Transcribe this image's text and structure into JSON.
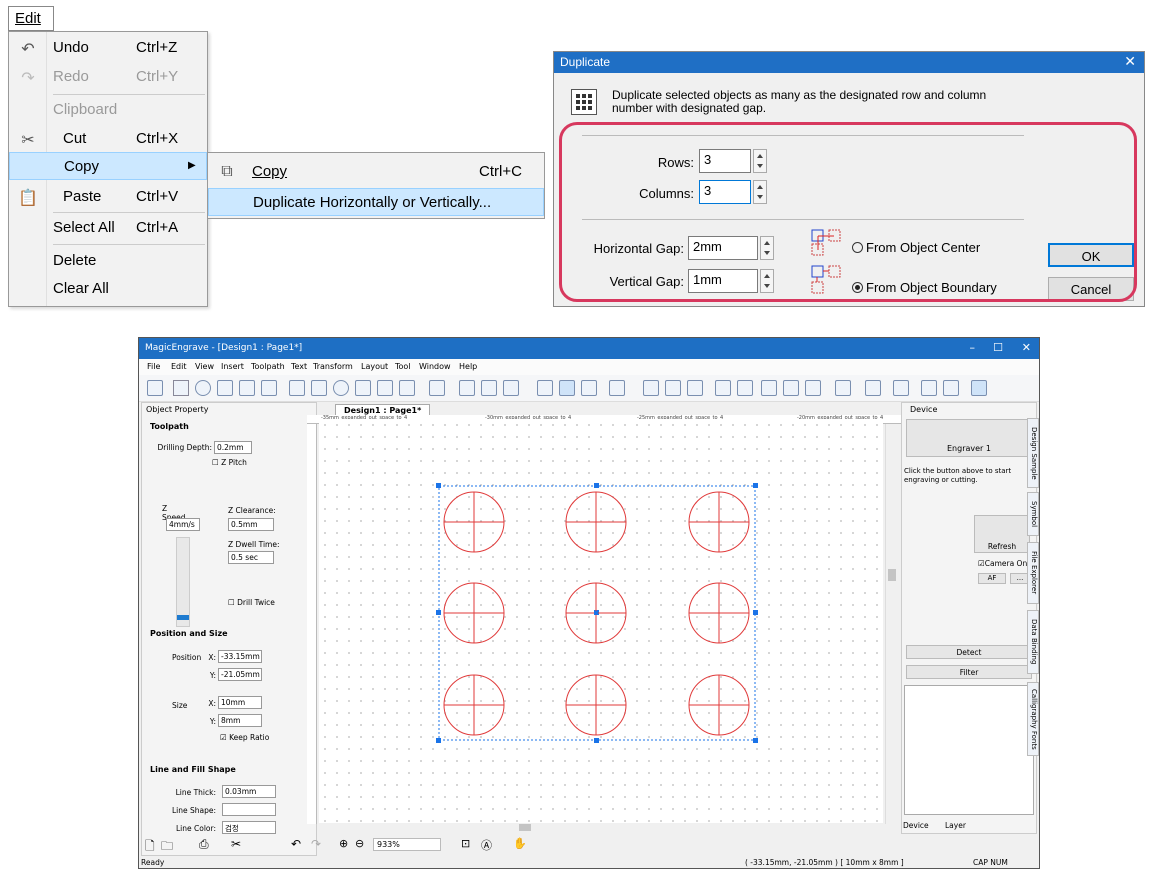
{
  "edit_menu": {
    "title": "Edit",
    "items": [
      {
        "label": "Undo",
        "shortcut": "Ctrl+Z",
        "icon": "undo-icon"
      },
      {
        "label": "Redo",
        "shortcut": "Ctrl+Y",
        "icon": "redo-icon",
        "disabled": true
      },
      {
        "label": "Clipboard",
        "disabled": true
      },
      {
        "label": "Cut",
        "shortcut": "Ctrl+X",
        "icon": "scissors-icon"
      },
      {
        "label": "Copy",
        "icon": "submenu-arrow-icon",
        "highlighted": true
      },
      {
        "label": "Paste",
        "shortcut": "Ctrl+V",
        "icon": "paste-icon"
      },
      {
        "label": "Select All",
        "shortcut": "Ctrl+A"
      },
      {
        "label": "Delete"
      },
      {
        "label": "Clear All"
      }
    ],
    "copy_submenu": [
      {
        "label": "Copy",
        "shortcut": "Ctrl+C"
      },
      {
        "label": "Duplicate Horizontally or Vertically..."
      }
    ]
  },
  "duplicate_dialog": {
    "title": "Duplicate",
    "description_line1": "Duplicate selected objects as many as the designated row and column",
    "description_line2": "number with designated gap.",
    "rows_label": "Rows:",
    "rows_value": "3",
    "columns_label": "Columns:",
    "columns_value": "3",
    "hgap_label": "Horizontal Gap:",
    "hgap_value": "2mm",
    "vgap_label": "Vertical Gap:",
    "vgap_value": "1mm",
    "from_center": "From Object Center",
    "from_boundary": "From Object Boundary",
    "ok": "OK",
    "cancel": "Cancel"
  },
  "app": {
    "title": "MagicEngrave - [Design1 : Page1*]",
    "menu": [
      "File",
      "Edit",
      "View",
      "Insert",
      "Toolpath",
      "Text",
      "Transform",
      "Layout",
      "Tool",
      "Window",
      "Help"
    ],
    "object_property": "Object Property",
    "toolpath": {
      "section": "Toolpath",
      "drilling_depth_label": "Drilling Depth:",
      "drilling_depth": "0.2mm",
      "z_pitch": "Z Pitch",
      "z_speed_label": "Z Speed",
      "z_speed": "4mm/s",
      "z_clearance_label": "Z Clearance:",
      "z_clearance": "0.5mm",
      "z_dwell_label": "Z Dwell Time:",
      "z_dwell": "0.5 sec",
      "drill_twice": "Drill Twice"
    },
    "position_size": {
      "section": "Position and Size",
      "position_label": "Position",
      "x_label": "X:",
      "x": "-33.15mm",
      "y_label": "Y:",
      "y": "-21.05mm",
      "size_label": "Size",
      "w_label": "X:",
      "w": "10mm",
      "h_label": "Y:",
      "h": "8mm",
      "keep_ratio": "Keep Ratio"
    },
    "line_fill": {
      "section": "Line and Fill Shape",
      "line_thick_label": "Line Thick:",
      "line_thick": "0.03mm",
      "line_shape_label": "Line Shape:",
      "line_color_label": "Line Color:",
      "line_color": "검정"
    },
    "doc_tab": "Design1 : Page1*",
    "ruler_labels": [
      "-35mm_expanded_out_space_to_4",
      "-30mm_expanded_out_space_to_4",
      "-25mm_expanded_out_space_to_4",
      "-20mm_expanded_out_space_to_4"
    ],
    "zoom": "933%",
    "device": {
      "header": "Device",
      "engraver": "Engraver 1",
      "hint": "Click the button above to start engraving or cutting.",
      "refresh": "Refresh",
      "camera_on": "Camera On",
      "af": "AF",
      "more": "...",
      "detect": "Detect",
      "filter": "Filter"
    },
    "bottom_tabs": [
      "Device",
      "Layer"
    ],
    "side_tabs": [
      "Design Sample",
      "Symbol",
      "File Explorer",
      "Data Binding",
      "Calligraphy Fonts"
    ],
    "status_left": "Ready",
    "status_coords": "( -33.15mm, -21.05mm )  [ 10mm x 8mm ]",
    "status_right": "CAP  NUM"
  },
  "colors": {
    "accent": "#1e6fc4",
    "highlight_ring": "#d7385e",
    "shape_stroke": "#e03a3a",
    "selection": "#1a73e8"
  }
}
